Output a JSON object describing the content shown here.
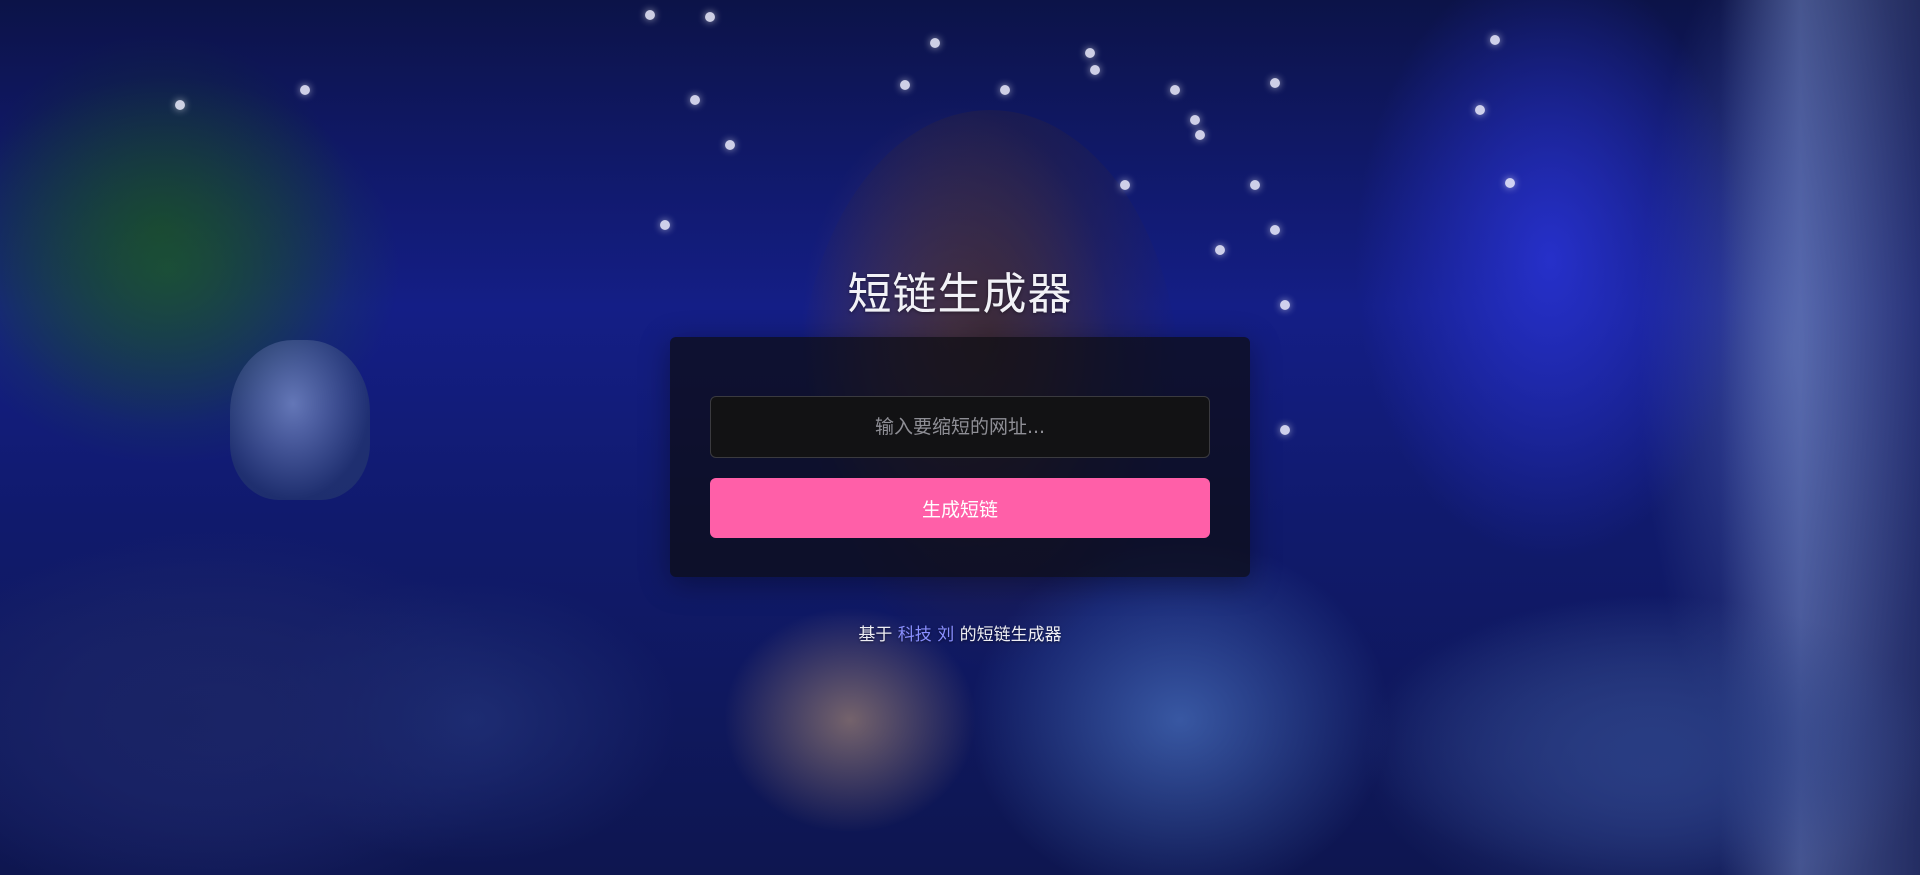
{
  "page": {
    "title": "短链生成器"
  },
  "form": {
    "url_placeholder": "输入要缩短的网址...",
    "url_value": "",
    "submit_label": "生成短链"
  },
  "footer": {
    "prefix": "基于",
    "link_text": "科技 刘",
    "suffix": "的短链生成器"
  },
  "colors": {
    "button_accent": "#ff5fa8",
    "link_color": "#8a8fff",
    "card_background": "#0c0c12"
  }
}
